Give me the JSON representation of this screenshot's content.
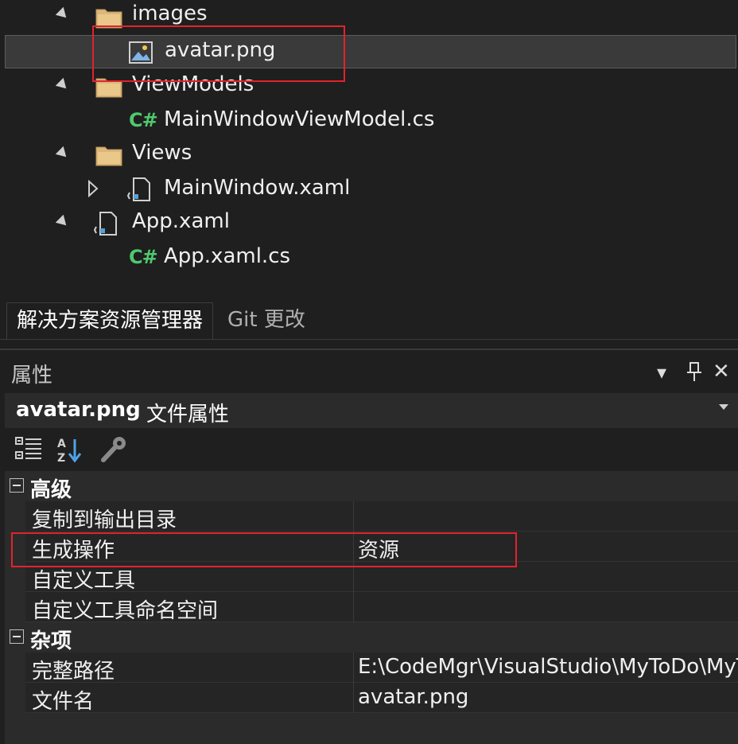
{
  "solution_explorer": {
    "items": [
      {
        "label": "images",
        "icon": "folder-icon"
      },
      {
        "label": "avatar.png",
        "icon": "image-file-icon"
      },
      {
        "label": "ViewModels",
        "icon": "folder-icon"
      },
      {
        "label": "MainWindowViewModel.cs",
        "icon": "csharp-file-icon",
        "icon_text": "C#"
      },
      {
        "label": "Views",
        "icon": "folder-icon"
      },
      {
        "label": "MainWindow.xaml",
        "icon": "xaml-file-icon"
      },
      {
        "label": "App.xaml",
        "icon": "xaml-file-icon"
      },
      {
        "label": "App.xaml.cs",
        "icon": "csharp-file-icon",
        "icon_text": "C#"
      }
    ],
    "tabs": [
      {
        "label": "解决方案资源管理器",
        "active": true
      },
      {
        "label": "Git 更改",
        "active": false
      }
    ]
  },
  "properties": {
    "title": "属性",
    "header_buttons": {
      "dropdown": "▾",
      "pin": "🖈",
      "close": "✕"
    },
    "object_name": "avatar.png",
    "object_kind": "文件属性",
    "categories": [
      {
        "label": "高级",
        "rows": [
          {
            "name": "复制到输出目录",
            "value": ""
          },
          {
            "name": "生成操作",
            "value": "资源"
          },
          {
            "name": "自定义工具",
            "value": ""
          },
          {
            "name": "自定义工具命名空间",
            "value": ""
          }
        ]
      },
      {
        "label": "杂项",
        "rows": [
          {
            "name": "完整路径",
            "value": "E:\\CodeMgr\\VisualStudio\\MyToDo\\MyToDo\\Assets\\images\\avatar.png"
          },
          {
            "name": "文件名",
            "value": "avatar.png"
          }
        ]
      }
    ]
  },
  "colors": {
    "background": "#1f1f1f",
    "panel": "#2b2b2b",
    "highlight": "#e3222c",
    "csharp": "#4ec96e",
    "folder": "#dcb67a",
    "image_icon": "#7fb4e8",
    "xaml_icon": "#5a9fd4"
  }
}
